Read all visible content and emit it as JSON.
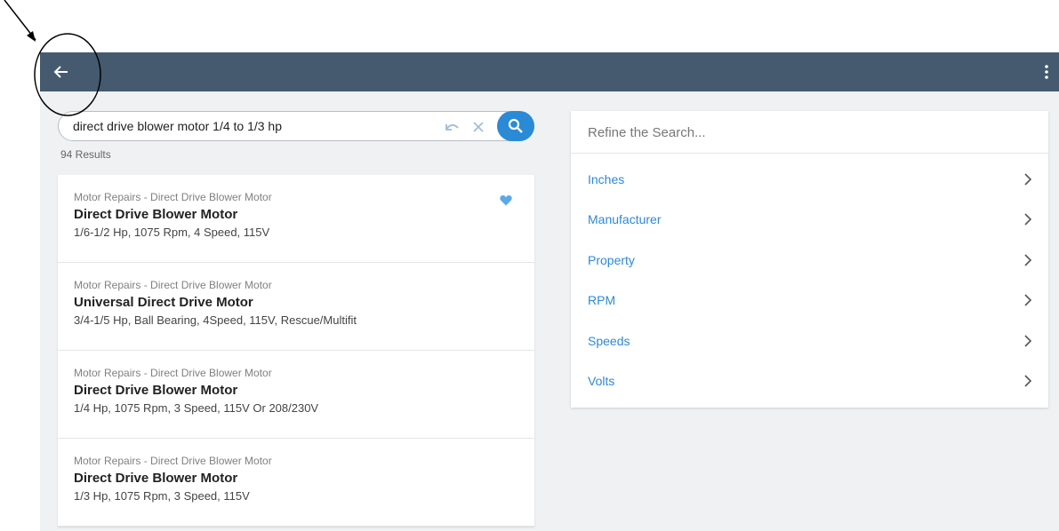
{
  "search": {
    "query": "direct drive blower motor 1/4 to 1/3 hp",
    "results_count": "94 Results"
  },
  "icons": {
    "back": "arrow-left-icon",
    "menu": "more-vert-icon",
    "undo": "undo-icon",
    "clear": "close-icon",
    "search": "search-icon",
    "favorite": "heart-icon",
    "chevron": "chevron-right-icon"
  },
  "colors": {
    "appbar": "#455a6e",
    "accent": "#2b8ad6",
    "favorite": "#5aa9e6",
    "annotation": "#000000"
  },
  "results": [
    {
      "category": "Motor Repairs - Direct Drive Blower Motor",
      "title": "Direct Drive Blower Motor",
      "description": "1/6-1/2 Hp, 1075 Rpm, 4 Speed, 115V",
      "favorited": true
    },
    {
      "category": "Motor Repairs - Direct Drive Blower Motor",
      "title": "Universal Direct Drive Motor",
      "description": "3/4-1/5 Hp, Ball Bearing, 4Speed, 115V, Rescue/Multifit",
      "favorited": false
    },
    {
      "category": "Motor Repairs - Direct Drive Blower Motor",
      "title": "Direct Drive Blower Motor",
      "description": "1/4 Hp, 1075 Rpm, 3 Speed, 115V Or 208/230V",
      "favorited": false
    },
    {
      "category": "Motor Repairs - Direct Drive Blower Motor",
      "title": "Direct Drive Blower Motor",
      "description": "1/3 Hp, 1075 Rpm, 3 Speed, 115V",
      "favorited": false
    }
  ],
  "refine": {
    "header": "Refine the Search...",
    "items": [
      {
        "label": "Inches"
      },
      {
        "label": "Manufacturer"
      },
      {
        "label": "Property"
      },
      {
        "label": "RPM"
      },
      {
        "label": "Speeds"
      },
      {
        "label": "Volts"
      }
    ]
  }
}
